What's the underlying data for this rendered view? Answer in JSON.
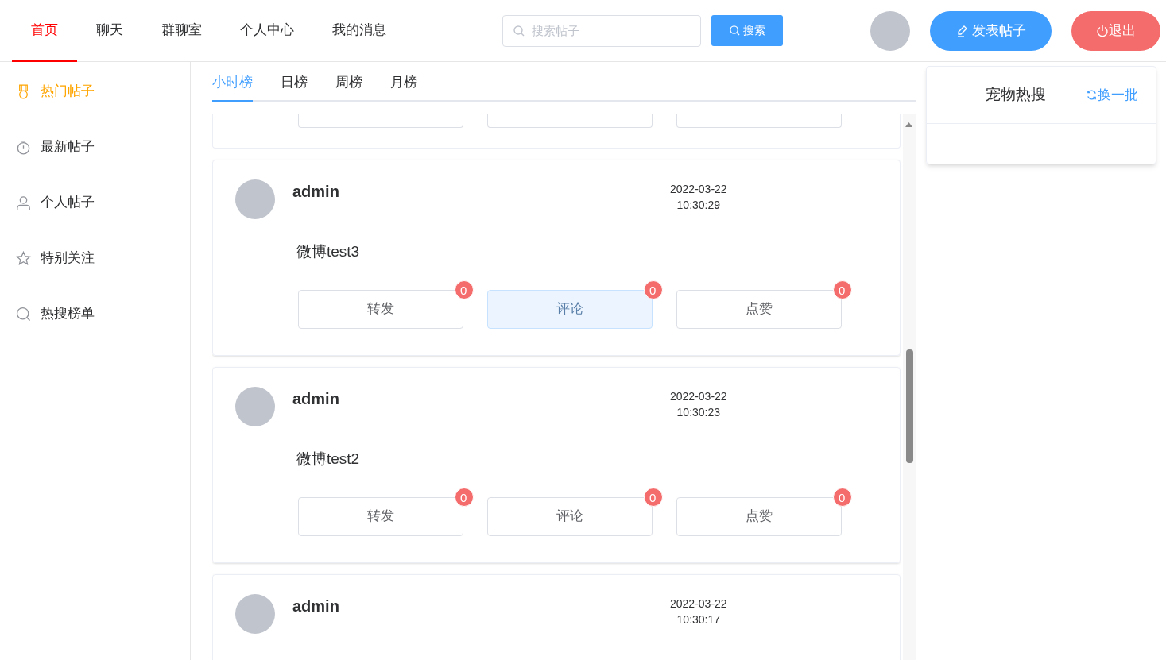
{
  "nav": {
    "tabs": [
      {
        "label": "首页",
        "selected": true
      },
      {
        "label": "聊天",
        "selected": false
      },
      {
        "label": "群聊室",
        "selected": false
      },
      {
        "label": "个人中心",
        "selected": false
      },
      {
        "label": "我的消息",
        "selected": false
      }
    ],
    "search": {
      "placeholder": "搜索帖子",
      "button": "搜索"
    },
    "post_button": "发表帖子",
    "logout_button": "退出"
  },
  "sidebar": {
    "items": [
      {
        "kind": "medal",
        "label": "热门帖子",
        "selected": true
      },
      {
        "kind": "timer",
        "label": "最新帖子",
        "selected": false
      },
      {
        "kind": "user",
        "label": "个人帖子",
        "selected": false
      },
      {
        "kind": "star",
        "label": "特别关注",
        "selected": false
      },
      {
        "kind": "search",
        "label": "热搜榜单",
        "selected": false
      }
    ]
  },
  "rank_tabs": [
    {
      "label": "小时榜",
      "selected": true
    },
    {
      "label": "日榜",
      "selected": false
    },
    {
      "label": "周榜",
      "selected": false
    },
    {
      "label": "月榜",
      "selected": false
    }
  ],
  "posts": [
    {
      "author": "admin",
      "date": "2022-03-22",
      "time": "10:30:29",
      "content": "微博test3",
      "actions": [
        {
          "label": "转发",
          "count": "0",
          "hovered": false
        },
        {
          "label": "评论",
          "count": "0",
          "hovered": true
        },
        {
          "label": "点赞",
          "count": "0",
          "hovered": false
        }
      ]
    },
    {
      "author": "admin",
      "date": "2022-03-22",
      "time": "10:30:23",
      "content": "微博test2",
      "actions": [
        {
          "label": "转发",
          "count": "0",
          "hovered": false
        },
        {
          "label": "评论",
          "count": "0",
          "hovered": false
        },
        {
          "label": "点赞",
          "count": "0",
          "hovered": false
        }
      ]
    },
    {
      "author": "admin",
      "date": "2022-03-22",
      "time": "10:30:17"
    }
  ],
  "hot_panel": {
    "title": "宠物热搜",
    "refresh": "换一批"
  }
}
